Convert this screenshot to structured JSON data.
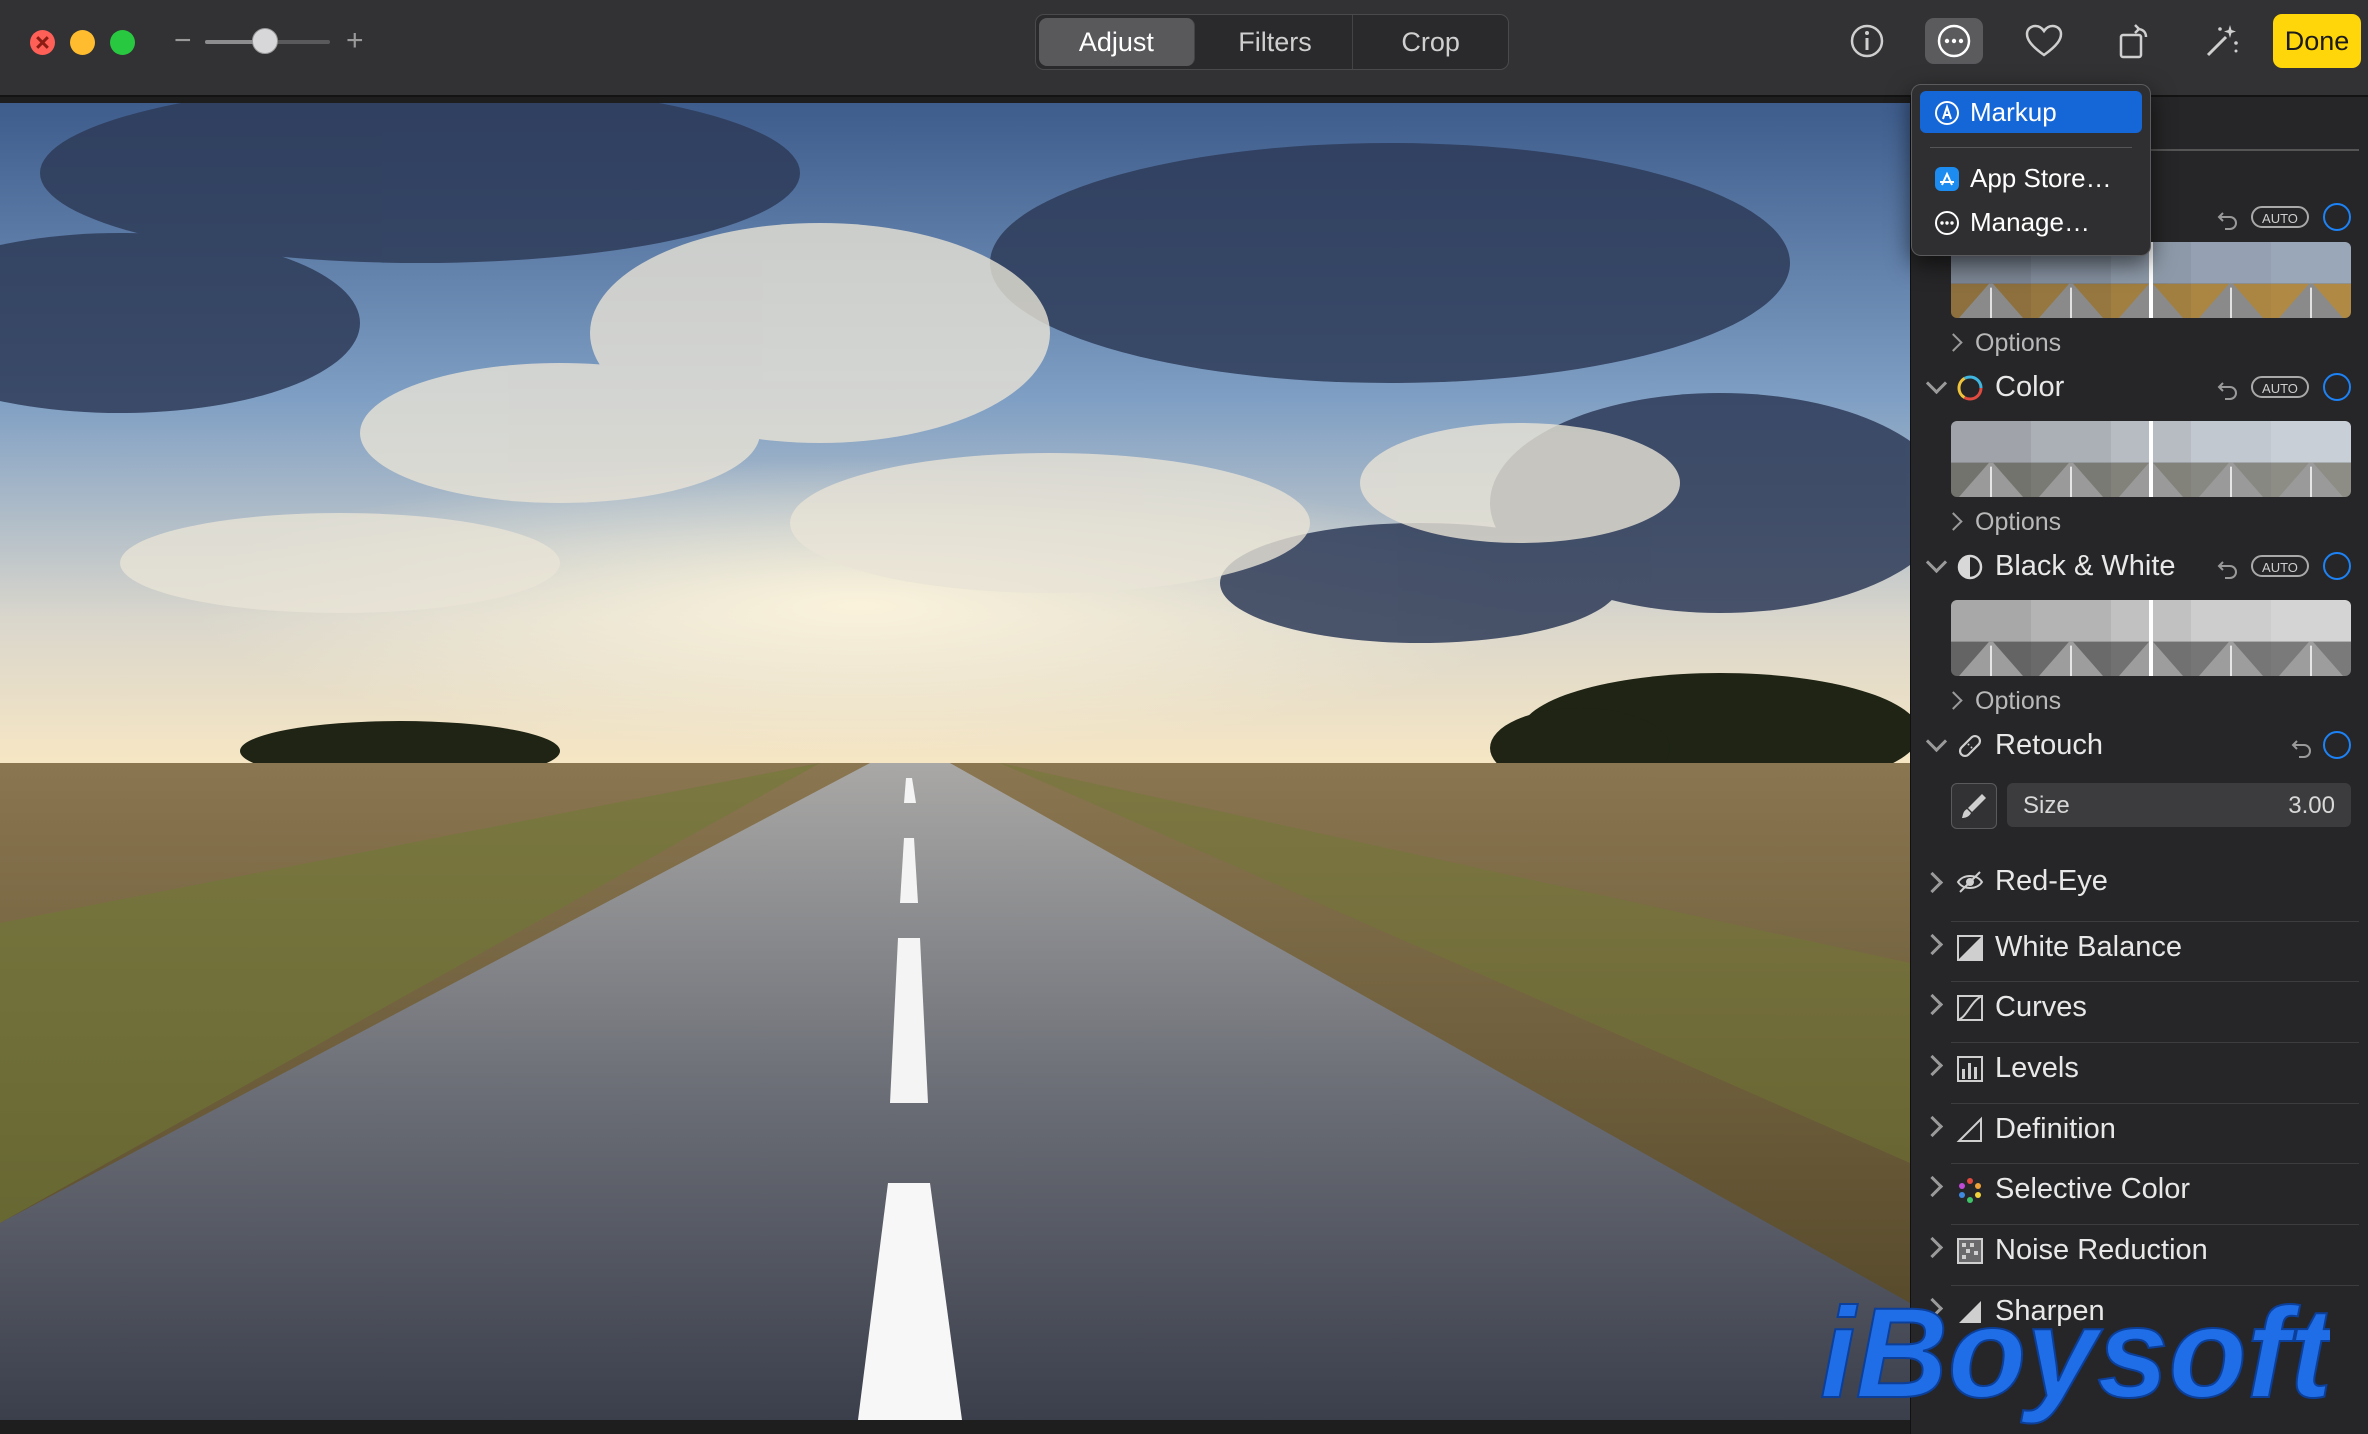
{
  "toolbar": {
    "zoom_minus": "−",
    "zoom_plus": "+",
    "zoom_level": 0.48,
    "tabs": [
      "Adjust",
      "Filters",
      "Crop"
    ],
    "active_tab": "Adjust",
    "done_label": "Done",
    "icons": [
      "info-icon",
      "extensions-icon",
      "heart-icon",
      "rotate-icon",
      "magic-wand-icon"
    ]
  },
  "extensions_menu": {
    "items": [
      {
        "label": "Markup",
        "icon": "markup-icon",
        "highlighted": true
      },
      {
        "label": "App Store…",
        "icon": "app-store-icon"
      },
      {
        "label": "Manage…",
        "icon": "more-icon"
      }
    ]
  },
  "sidebar": {
    "sections": [
      {
        "title": "Color",
        "auto": "AUTO",
        "options": "Options"
      },
      {
        "title": "Black & White",
        "auto": "AUTO",
        "options": "Options"
      },
      {
        "title": "Retouch"
      }
    ],
    "light_options": "Options",
    "light_auto": "AUTO",
    "retouch": {
      "size_label": "Size",
      "size_value": "3.00"
    },
    "tools": [
      "Red-Eye",
      "White Balance",
      "Curves",
      "Levels",
      "Definition",
      "Selective Color",
      "Noise Reduction",
      "Sharpen"
    ]
  },
  "watermark": "iBoysoft",
  "colors": {
    "accent_blue": "#1c82f6",
    "done_yellow": "#ffd60a",
    "menu_highlight": "#1566d6"
  }
}
